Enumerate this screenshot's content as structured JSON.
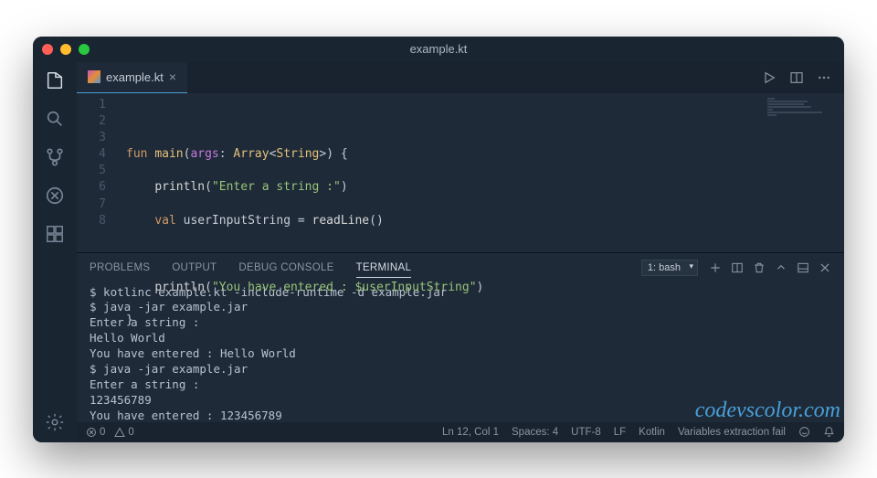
{
  "window": {
    "title": "example.kt"
  },
  "tab": {
    "filename": "example.kt"
  },
  "code": {
    "lines": {
      "l1": "",
      "l2_kw1": "fun",
      "l2_fn": "main",
      "l2_paren1": "(",
      "l2_param": "args",
      "l2_colon": ":",
      "l2_type1": "Array",
      "l2_lt": "<",
      "l2_type2": "String",
      "l2_gt": ">",
      "l2_paren2": ")",
      "l2_brace": " {",
      "l3_indent": "    ",
      "l3_call": "println",
      "l3_paren1": "(",
      "l3_str": "\"Enter a string :\"",
      "l3_paren2": ")",
      "l4_indent": "    ",
      "l4_kw": "val",
      "l4_var": " userInputString ",
      "l4_eq": "=",
      "l4_call": " readLine",
      "l4_paren": "()",
      "l5": "",
      "l6_indent": "    ",
      "l6_call": "println",
      "l6_paren1": "(",
      "l6_str": "\"You have entered : $userInputString\"",
      "l6_paren2": ")",
      "l7": "}",
      "l8": ""
    },
    "line_numbers": {
      "n1": "1",
      "n2": "2",
      "n3": "3",
      "n4": "4",
      "n5": "5",
      "n6": "6",
      "n7": "7",
      "n8": "8"
    }
  },
  "panel": {
    "tabs": {
      "problems": "PROBLEMS",
      "output": "OUTPUT",
      "debug": "DEBUG CONSOLE",
      "terminal": "TERMINAL"
    },
    "terminal_selector": "1: bash"
  },
  "terminal": {
    "l1": "$ kotlinc example.kt -include-runtime -d example.jar",
    "l2": "$ java -jar example.jar",
    "l3": "Enter a string :",
    "l4": "Hello World",
    "l5": "You have entered : Hello World",
    "l6": "$ java -jar example.jar",
    "l7": "Enter a string :",
    "l8": "123456789",
    "l9": "You have entered : 123456789",
    "l10": "$ "
  },
  "statusbar": {
    "errors": "0",
    "warnings": "0",
    "position": "Ln 12, Col 1",
    "spaces": "Spaces: 4",
    "encoding": "UTF-8",
    "eol": "LF",
    "language": "Kotlin",
    "extra": "Variables extraction fail"
  },
  "watermark": "codevscolor.com"
}
